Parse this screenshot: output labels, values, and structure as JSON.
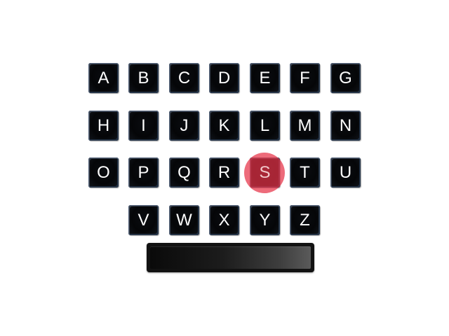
{
  "keyboard": {
    "rows": [
      [
        "A",
        "B",
        "C",
        "D",
        "E",
        "F",
        "G"
      ],
      [
        "H",
        "I",
        "J",
        "K",
        "L",
        "M",
        "N"
      ],
      [
        "O",
        "P",
        "Q",
        "R",
        "S",
        "T",
        "U"
      ],
      [
        "V",
        "W",
        "X",
        "Y",
        "Z"
      ]
    ],
    "selected_key": "S",
    "highlight_color": "#e63246",
    "key_color": "#050608",
    "key_text_color": "#ffffff"
  },
  "space_bar": {
    "label": ""
  }
}
